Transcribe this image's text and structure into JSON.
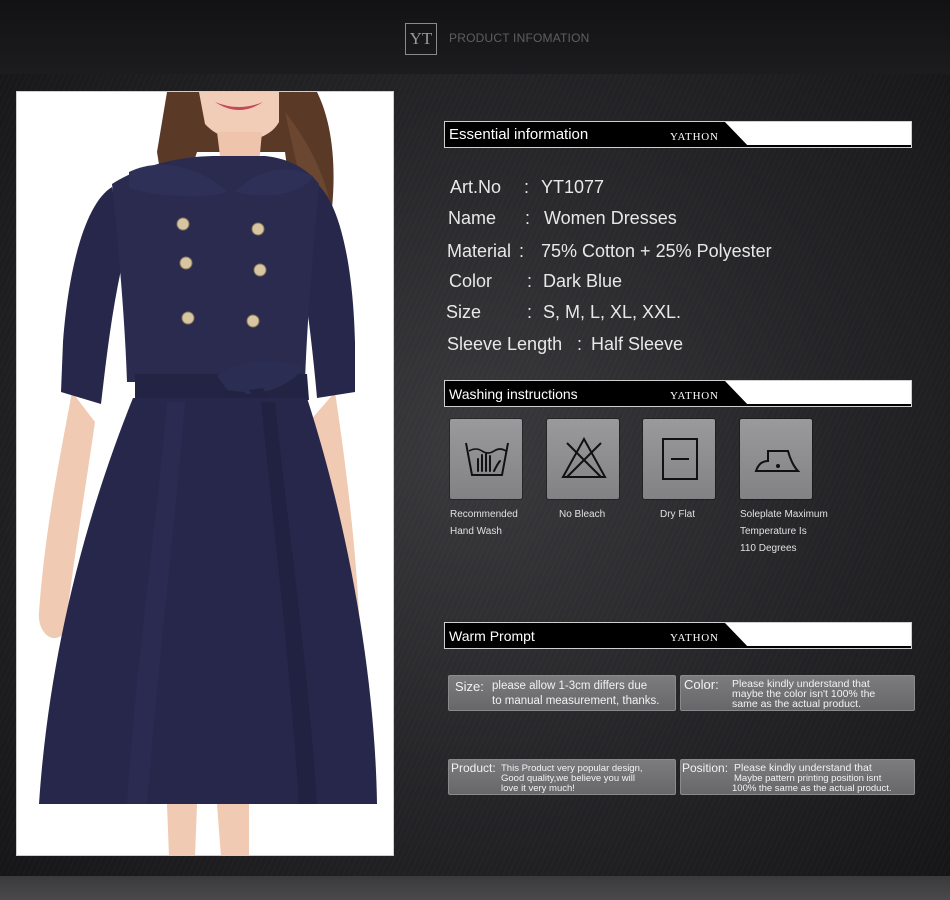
{
  "header": {
    "logo_text": "YT",
    "title": "PRODUCT INFOMATION"
  },
  "brand": "YATHON",
  "essential": {
    "section_title": "Essential information",
    "rows": [
      {
        "label": "Art.No",
        "colon": ":",
        "value": "YT1077"
      },
      {
        "label": "Name",
        "colon": ":",
        "value": "Women Dresses"
      },
      {
        "label": "Material",
        "colon": ":",
        "value": "75% Cotton + 25% Polyester"
      },
      {
        "label": "Color",
        "colon": ":",
        "value": "Dark Blue"
      },
      {
        "label": "Size",
        "colon": ":",
        "value": "S, M, L, XL, XXL."
      },
      {
        "label": "Sleeve Length",
        "colon": ":",
        "value": "Half  Sleeve"
      }
    ]
  },
  "washing": {
    "section_title": "Washing instructions",
    "items": [
      {
        "icon": "hand-wash-icon",
        "line1": "Recommended",
        "line2": "Hand Wash",
        "line3": ""
      },
      {
        "icon": "no-bleach-icon",
        "line1": "No Bleach",
        "line2": "",
        "line3": ""
      },
      {
        "icon": "dry-flat-icon",
        "line1": "Dry Flat",
        "line2": "",
        "line3": ""
      },
      {
        "icon": "iron-icon",
        "line1": "Soleplate Maximum",
        "line2": "Temperature Is",
        "line3": "110 Degrees"
      }
    ]
  },
  "warm": {
    "section_title": "Warm Prompt",
    "prompts": [
      {
        "key": "Size:",
        "line1": "please allow 1-3cm differs due",
        "line2": "to manual measurement, thanks.",
        "line3": ""
      },
      {
        "key": "Color:",
        "line1": "Please kindly understand that",
        "line2": "maybe the color isn't 100% the",
        "line3": "same as the actual product."
      },
      {
        "key": "Product:",
        "line1": "This Product very popular design,",
        "line2": "Good quality,we believe you will",
        "line3": "love it very much!"
      },
      {
        "key": "Position:",
        "line1": "Please kindly understand that",
        "line2": "Maybe pattern printing position isnt",
        "line3": "100% the same as the actual product."
      }
    ]
  },
  "colors": {
    "dress": "#27284a",
    "background": "#242427"
  }
}
